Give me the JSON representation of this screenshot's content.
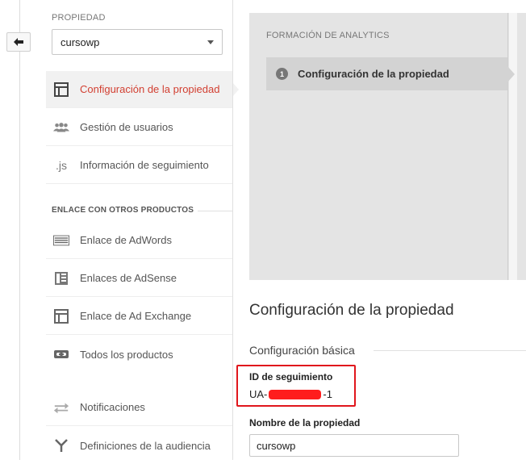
{
  "property": {
    "label": "PROPIEDAD",
    "selected": "cursowp"
  },
  "sidebar": {
    "items": [
      {
        "label": "Configuración de la propiedad",
        "icon": "property-settings-icon"
      },
      {
        "label": "Gestión de usuarios",
        "icon": "users-icon"
      },
      {
        "label": "Información de seguimiento",
        "icon": "js-icon",
        "icon_text": ".js"
      }
    ],
    "section_heading": "ENLACE CON OTROS PRODUCTOS",
    "products": [
      {
        "label": "Enlace de AdWords",
        "icon": "adwords-icon"
      },
      {
        "label": "Enlaces de AdSense",
        "icon": "adsense-icon"
      },
      {
        "label": "Enlace de Ad Exchange",
        "icon": "ad-exchange-icon"
      },
      {
        "label": "Todos los productos",
        "icon": "link-icon"
      }
    ],
    "more": [
      {
        "label": "Notificaciones",
        "icon": "notifications-icon"
      },
      {
        "label": "Definiciones de la audiencia",
        "icon": "audience-icon"
      }
    ]
  },
  "main": {
    "panel_title": "FORMACIÓN DE ANALYTICS",
    "step_number": "1",
    "step_label": "Configuración de la propiedad",
    "page_title": "Configuración de la propiedad",
    "subsection": "Configuración básica",
    "tracking_id_label": "ID de seguimiento",
    "tracking_id_prefix": "UA-",
    "tracking_id_suffix": "-1",
    "property_name_label": "Nombre de la propiedad",
    "property_name_value": "cursowp"
  },
  "colors": {
    "active": "#d23f31",
    "highlight": "#e0161c"
  }
}
